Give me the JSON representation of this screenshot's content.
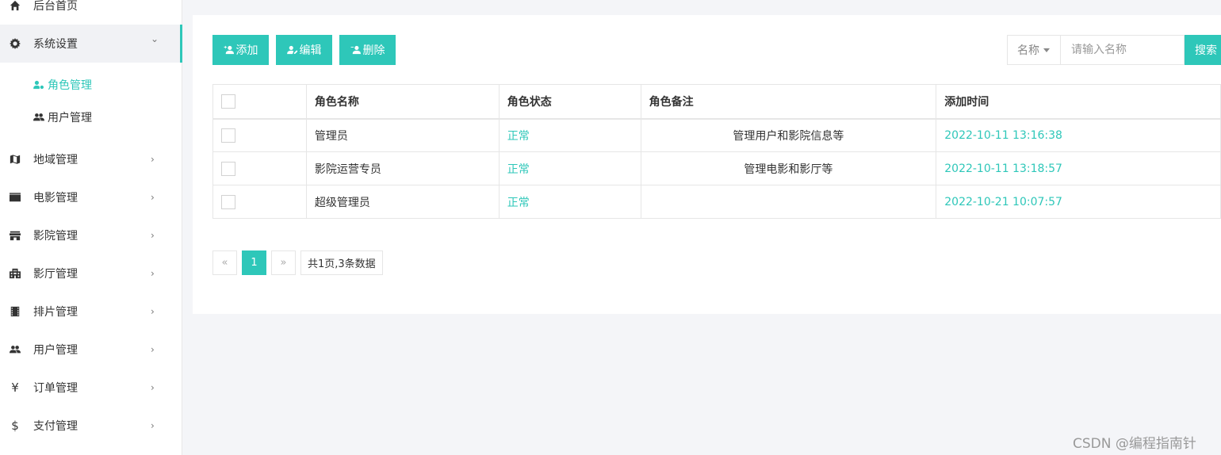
{
  "sidebar": {
    "home": "后台首页",
    "system": "系统设置",
    "system_sub": [
      "角色管理",
      "用户管理"
    ],
    "items": [
      "地域管理",
      "电影管理",
      "影院管理",
      "影厅管理",
      "排片管理",
      "用户管理",
      "订单管理",
      "支付管理"
    ],
    "chevron_right": "›",
    "chevron_down": "⌄"
  },
  "toolbar": {
    "add": "添加",
    "edit": "编辑",
    "delete": "删除"
  },
  "search": {
    "field": "名称",
    "placeholder": "请输入名称",
    "button": "搜索"
  },
  "table": {
    "headers": [
      "角色名称",
      "角色状态",
      "角色备注",
      "添加时间"
    ],
    "rows": [
      {
        "name": "管理员",
        "status": "正常",
        "remark": "管理用户和影院信息等",
        "time": "2022-10-11 13:16:38"
      },
      {
        "name": "影院运营专员",
        "status": "正常",
        "remark": "管理电影和影厅等",
        "time": "2022-10-11 13:18:57"
      },
      {
        "name": "超级管理员",
        "status": "正常",
        "remark": "",
        "time": "2022-10-21 10:07:57"
      }
    ]
  },
  "pagination": {
    "prev": "«",
    "current": "1",
    "next": "»",
    "info": "共1页,3条数据"
  },
  "watermark": "CSDN @编程指南针",
  "colors": {
    "accent": "#2ec7b9"
  },
  "icons": [
    "home-icon",
    "gear-icon",
    "user-tag-icon",
    "users-icon",
    "map-icon",
    "film-icon",
    "store-icon",
    "building-icon",
    "filmstrip-icon",
    "yen-icon",
    "dollar-icon"
  ]
}
